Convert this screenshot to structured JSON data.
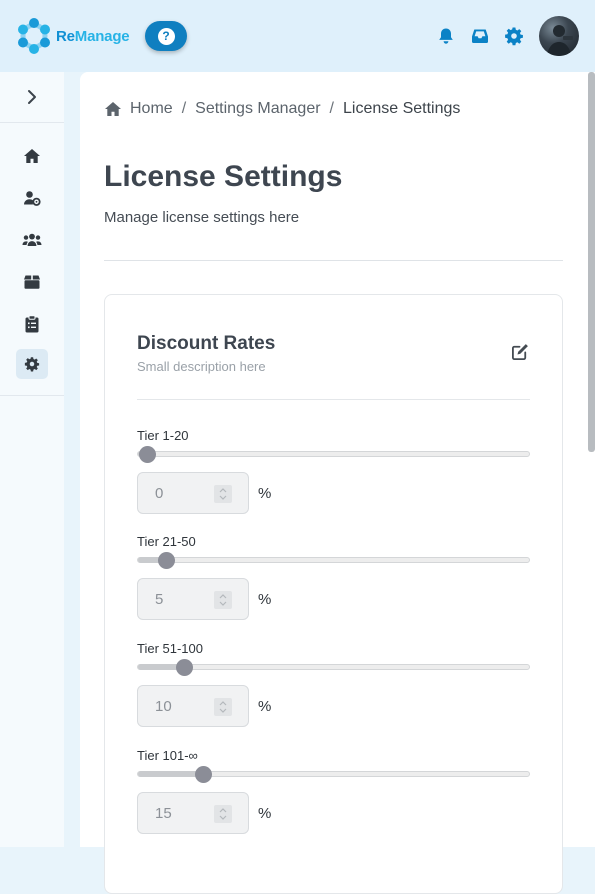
{
  "app": {
    "brand_prefix": "Re",
    "brand_suffix": "Manage",
    "help_label": "?"
  },
  "topbar": {
    "icons": [
      "bell-icon",
      "inbox-icon",
      "gear-icon",
      "avatar"
    ],
    "accent_color": "#0f7fc0"
  },
  "sidebar": {
    "items": [
      {
        "name": "home",
        "icon": "home-icon",
        "active": false
      },
      {
        "name": "user-settings",
        "icon": "user-gear-icon",
        "active": false
      },
      {
        "name": "users",
        "icon": "users-icon",
        "active": false
      },
      {
        "name": "packages",
        "icon": "box-icon",
        "active": false
      },
      {
        "name": "clipboard",
        "icon": "clipboard-icon",
        "active": false
      },
      {
        "name": "settings",
        "icon": "gear-icon",
        "active": true
      }
    ]
  },
  "breadcrumb": {
    "items": [
      "Home",
      "Settings Manager",
      "License Settings"
    ],
    "separator": "/"
  },
  "page": {
    "title": "License Settings",
    "subtitle": "Manage license settings here"
  },
  "card": {
    "title": "Discount Rates",
    "description": "Small description here",
    "tiers": [
      {
        "label": "Tier 1-20",
        "value": "0",
        "unit": "%",
        "slider_fraction": 0.0
      },
      {
        "label": "Tier 21-50",
        "value": "5",
        "unit": "%",
        "slider_fraction": 0.05
      },
      {
        "label": "Tier 51-100",
        "value": "10",
        "unit": "%",
        "slider_fraction": 0.1
      },
      {
        "label": "Tier 101-∞",
        "value": "15",
        "unit": "%",
        "slider_fraction": 0.15
      }
    ]
  }
}
